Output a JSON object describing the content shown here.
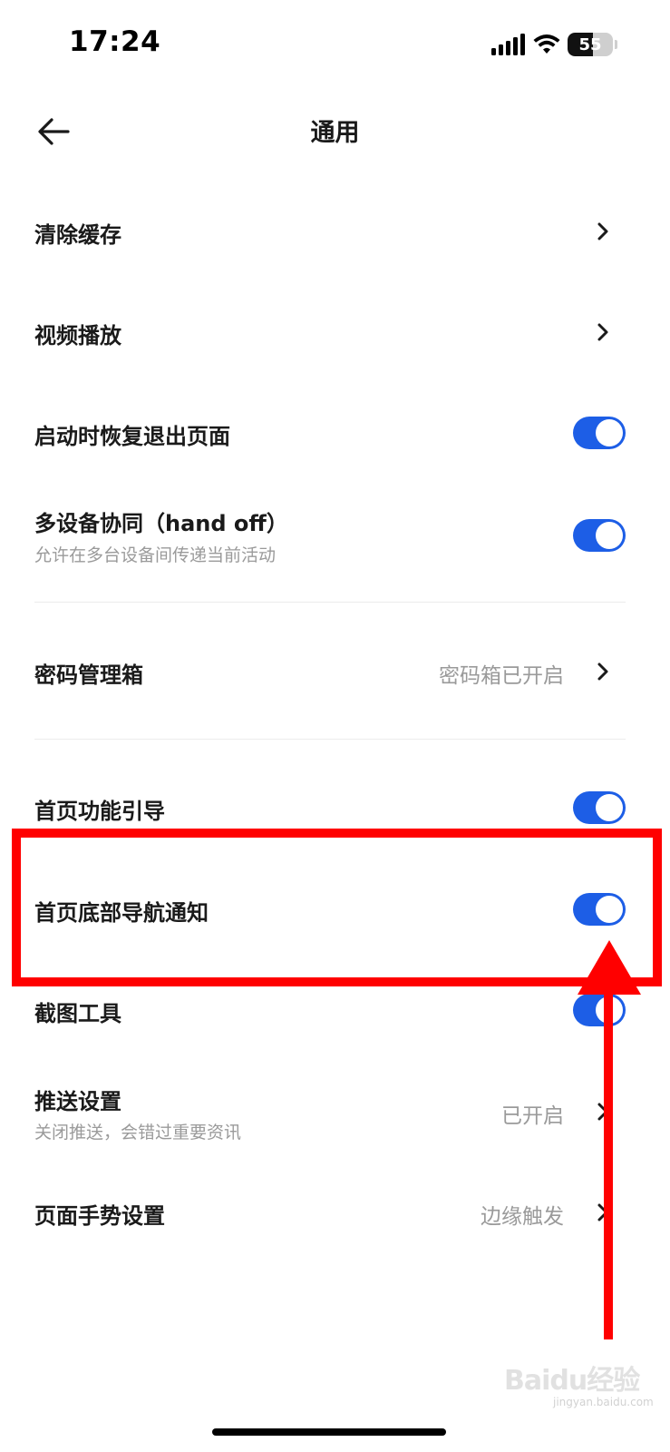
{
  "status_bar": {
    "time": "17:24",
    "battery_level": "55",
    "battery_fraction": 0.55
  },
  "header": {
    "title": "通用",
    "back_icon": "arrow-left-icon"
  },
  "settings": {
    "clear_cache": {
      "label": "清除缓存",
      "icon": "chevron-right-icon"
    },
    "video_playback": {
      "label": "视频播放",
      "icon": "chevron-right-icon"
    },
    "restore_pages": {
      "label": "启动时恢复退出页面",
      "enabled": true
    },
    "handoff": {
      "label": "多设备协同（hand off）",
      "subtitle": "允许在多台设备间传递当前活动",
      "enabled": true
    },
    "password_manager": {
      "label": "密码管理箱",
      "value": "密码箱已开启",
      "icon": "chevron-right-icon"
    },
    "home_guide": {
      "label": "首页功能引导",
      "enabled": true
    },
    "home_bottom_nav": {
      "label": "首页底部导航通知",
      "enabled": true
    },
    "screenshot_tool": {
      "label": "截图工具",
      "enabled": true
    },
    "push": {
      "label": "推送设置",
      "subtitle": "关闭推送，会错过重要资讯",
      "value": "已开启",
      "icon": "chevron-right-icon"
    },
    "gesture": {
      "label": "页面手势设置",
      "value": "边缘触发",
      "icon": "chevron-right-icon"
    }
  },
  "colors": {
    "toggle_on": "#1d5ee6",
    "annotation": "#ff0000",
    "secondary_text": "#9a9a9a"
  },
  "watermark": {
    "brand": "Baidu经验",
    "url": "jingyan.baidu.com"
  }
}
